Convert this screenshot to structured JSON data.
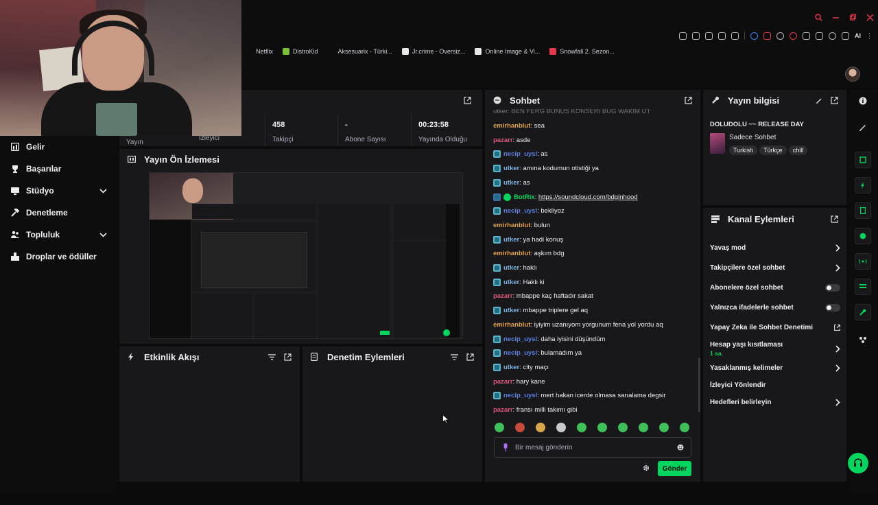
{
  "browser": {
    "bookmarks": [
      {
        "label": "Netflix",
        "color": "#0d0d0e"
      },
      {
        "label": "DistroKid",
        "color": "#7bbf3a"
      },
      {
        "label": "Aksesuarix - Türki...",
        "color": "#0d0d0e"
      },
      {
        "label": "Jr.crime - Oversiz...",
        "color": "#e7e7e9"
      },
      {
        "label": "Online Image & Vi...",
        "color": "#e7e7e9"
      },
      {
        "label": "Snowfall 2. Sezon...",
        "color": "#e5394b"
      }
    ],
    "ai_label": "AI"
  },
  "nav": {
    "items": [
      {
        "label": "Gelir",
        "icon": "revenue-icon"
      },
      {
        "label": "Başarılar",
        "icon": "trophy-icon"
      },
      {
        "label": "Stüdyo",
        "icon": "studio-icon",
        "expandable": true
      },
      {
        "label": "Denetleme",
        "icon": "hammer-icon"
      },
      {
        "label": "Topluluk",
        "icon": "community-icon",
        "expandable": true
      },
      {
        "label": "Droplar ve ödüller",
        "icon": "drops-icon"
      }
    ]
  },
  "stats": {
    "partial_label_1": "Yayın",
    "partial_label_2": "İzleyici",
    "cells": [
      {
        "value": "458",
        "label": "Takipçi"
      },
      {
        "value": "-",
        "label": "Abone Sayısı"
      },
      {
        "value": "00:23:58",
        "label": "Yayında Olduğu"
      }
    ]
  },
  "preview": {
    "title": "Yayın Ön İzlemesi"
  },
  "activity": {
    "title": "Etkinlik Akışı"
  },
  "mod_actions": {
    "title": "Denetim Eylemleri"
  },
  "chat": {
    "title": "Sohbet",
    "partial_top": "utker: BEN FERG BUNUŞ KONSERI BUG WAKIM UT",
    "messages": [
      {
        "user": "emirhanblut",
        "color": "#dfa24d",
        "badge": false,
        "text": "sea"
      },
      {
        "user": "pazarr",
        "color": "#e0577b",
        "badge": false,
        "text": "asde"
      },
      {
        "user": "necip_uysl",
        "color": "#5b7fe0",
        "badge": true,
        "text": "as"
      },
      {
        "user": "utker",
        "color": "#7ab3e0",
        "badge": true,
        "text": "amına kodumun otistiği ya"
      },
      {
        "user": "utker",
        "color": "#7ab3e0",
        "badge": true,
        "text": "as"
      },
      {
        "user": "BotRix",
        "color": "#00d65f",
        "badge": true,
        "link": "https://soundcloud.com/bdginhood",
        "text": ""
      },
      {
        "user": "necip_uysl",
        "color": "#5b7fe0",
        "badge": true,
        "text": "bekliyoz"
      },
      {
        "user": "emirhanblut",
        "color": "#dfa24d",
        "badge": false,
        "text": "bulun"
      },
      {
        "user": "utker",
        "color": "#7ab3e0",
        "badge": true,
        "text": "ya hadi konuş"
      },
      {
        "user": "emirhanblut",
        "color": "#dfa24d",
        "badge": false,
        "text": "aşkım bdg"
      },
      {
        "user": "utker",
        "color": "#7ab3e0",
        "badge": true,
        "text": "haklı"
      },
      {
        "user": "utker",
        "color": "#7ab3e0",
        "badge": true,
        "text": "Haklı ki"
      },
      {
        "user": "pazarr",
        "color": "#e0577b",
        "badge": false,
        "text": "mbappe kaç haftadır sakat"
      },
      {
        "user": "utker",
        "color": "#7ab3e0",
        "badge": true,
        "text": "mbappe triplere gel aq"
      },
      {
        "user": "emirhanblut",
        "color": "#dfa24d",
        "badge": false,
        "text": "iyiyim uzanıyom yorgunum fena yol yordu aq"
      },
      {
        "user": "necip_uysl",
        "color": "#5b7fe0",
        "badge": true,
        "text": "daha iyisini düşündüm"
      },
      {
        "user": "necip_uysl",
        "color": "#5b7fe0",
        "badge": true,
        "text": "bulamadım ya"
      },
      {
        "user": "utker",
        "color": "#7ab3e0",
        "badge": true,
        "text": "city maçı"
      },
      {
        "user": "pazarr",
        "color": "#e0577b",
        "badge": false,
        "text": "hary kane"
      },
      {
        "user": "necip_uysl",
        "color": "#5b7fe0",
        "badge": true,
        "text": "mert hakan icerde olmasa sarıalama degsir"
      },
      {
        "user": "pazarr",
        "color": "#e0577b",
        "badge": false,
        "text": "fransı milli takımı gibi"
      }
    ],
    "input_placeholder": "Bir mesaj gönderin",
    "send_label": "Gönder"
  },
  "stream_info": {
    "title": "Yayın bilgisi",
    "stream_title": "DOLUDOLU ~~ RELEASE DAY",
    "category": "Sadece Sohbet",
    "tags": [
      "Turkish",
      "Türkçe",
      "chill"
    ]
  },
  "channel_actions": {
    "title": "Kanal Eylemleri",
    "items": [
      {
        "label": "Yavaş mod",
        "control": "chevron"
      },
      {
        "label": "Takipçilere özel sohbet",
        "control": "chevron"
      },
      {
        "label": "Abonelere özel sohbet",
        "control": "toggle"
      },
      {
        "label": "Yalnızca ifadelerle sohbet",
        "control": "toggle"
      },
      {
        "label": "Yapay Zeka ile Sohbet Denetimi",
        "control": "external"
      },
      {
        "label": "Hesap yaşı kısıtlaması",
        "sublabel": "1 sa.",
        "control": "chevron"
      },
      {
        "label": "Yasaklanmış kelimeler",
        "control": "chevron"
      },
      {
        "label": "İzleyici Yönlendir",
        "control": "none"
      },
      {
        "label": "Hedefleri belirleyin",
        "control": "chevron"
      }
    ]
  },
  "colors": {
    "accent": "#00d65f",
    "panel": "#18181b",
    "bg": "#0b0b0c"
  }
}
